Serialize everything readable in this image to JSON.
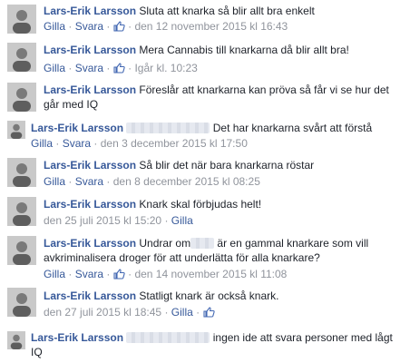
{
  "author": "Lars-Erik Larsson",
  "actions": {
    "reply": "Svara",
    "like": "Gilla",
    "dot": "·"
  },
  "comments": [
    {
      "text": "Sluta att knarka så blir allt bra enkelt",
      "time": "den 12 november 2015 kl 16:43"
    },
    {
      "text": "Mera Cannabis till knarkarna då blir allt bra!",
      "time": "Igår kl. 10:23"
    },
    {
      "text": "Föreslår att knarkarna kan pröva så får vi se hur det går med IQ",
      "time": ""
    },
    {
      "text": "Det har knarkarna svårt att förstå",
      "time": "den 3 december 2015 kl 17:50"
    },
    {
      "text": "Så blir det när bara knarkarna röstar",
      "time": "den 8 december 2015 kl 08:25"
    },
    {
      "text": "Knark skal förbjudas helt!",
      "time": "den 25 juli 2015 kl 15:20"
    },
    {
      "text_a": "Undrar om",
      "text_b": "är en gammal knarkare som vill avkriminalisera droger för att underlätta för alla knarkare?",
      "time": "den 14 november 2015 kl 11:08"
    },
    {
      "text": "Statligt knark är också knark.",
      "time": "den 27 juli 2015 kl 18:45"
    },
    {
      "text": "ingen ide att svara personer med lågt IQ",
      "time": ""
    }
  ]
}
